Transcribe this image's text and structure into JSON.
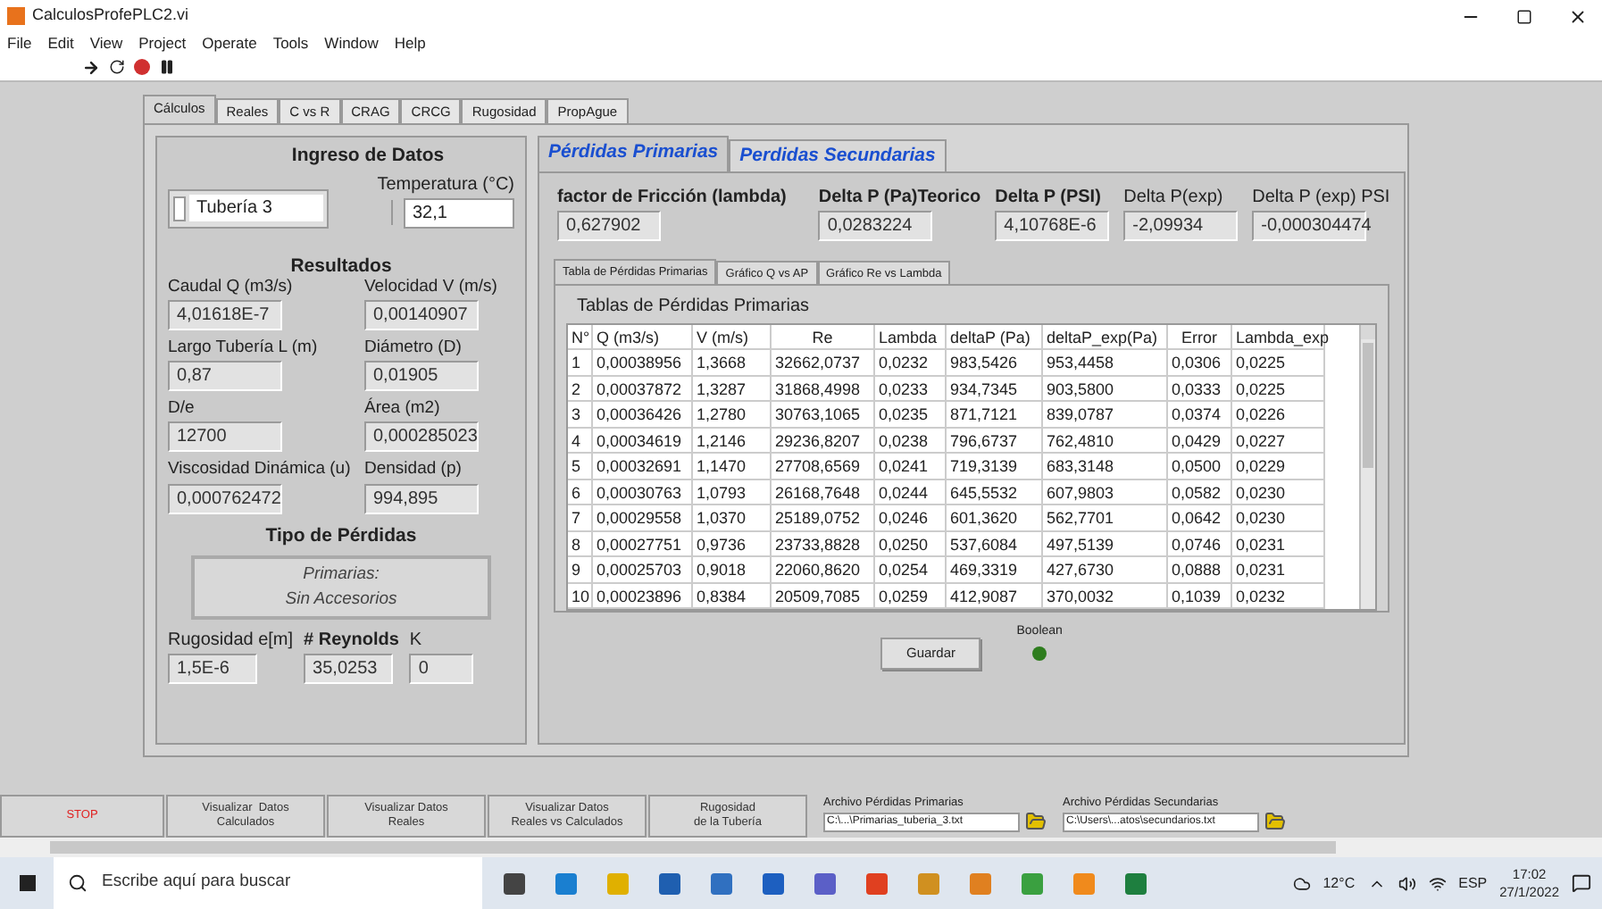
{
  "window": {
    "title": "CalculosProfePLC2.vi"
  },
  "menu": [
    "File",
    "Edit",
    "View",
    "Project",
    "Operate",
    "Tools",
    "Window",
    "Help"
  ],
  "tabs": [
    {
      "label": "Cálculos",
      "selected": true
    },
    {
      "label": "Reales",
      "selected": false
    },
    {
      "label": "C vs R",
      "selected": false
    },
    {
      "label": "CRAG",
      "selected": false
    },
    {
      "label": "CRCG",
      "selected": false
    },
    {
      "label": "Rugosidad",
      "selected": false
    },
    {
      "label": "PropAgue",
      "selected": false
    }
  ],
  "ingreso": {
    "title": "Ingreso de Datos",
    "pipe": "Tubería 3",
    "temp_label": "Temperatura (°C)",
    "temp_value": "32,1"
  },
  "resultados": {
    "title": "Resultados",
    "fields": [
      {
        "label": "Caudal Q (m3/s)",
        "value": "4,01618E-7"
      },
      {
        "label": "Velocidad V (m/s)",
        "value": "0,00140907"
      },
      {
        "label": "Largo Tubería L (m)",
        "value": "0,87"
      },
      {
        "label": "Diámetro (D)",
        "value": "0,01905"
      },
      {
        "label": "D/e",
        "value": "12700"
      },
      {
        "label": "Área (m2)",
        "value": "0,000285023"
      },
      {
        "label": "Viscosidad Dinámica (u)",
        "value": "0,000762472"
      },
      {
        "label": "Densidad (p)",
        "value": "994,895"
      }
    ]
  },
  "tipo": {
    "title": "Tipo de Pérdidas",
    "lines": [
      "Primarias:",
      "Sin Accesorios"
    ]
  },
  "bottom_fields": [
    {
      "label": "Rugosidad e[m]",
      "value": "1,5E-6",
      "bold": false
    },
    {
      "label": "# Reynolds",
      "value": "35,0253",
      "bold": true
    },
    {
      "label": "K",
      "value": "0",
      "bold": false
    }
  ],
  "subtabs": [
    {
      "label": "Pérdidas Primarias",
      "selected": true
    },
    {
      "label": "Perdidas Secundarias",
      "selected": false
    }
  ],
  "summary": [
    {
      "label": "factor de Fricción (lambda)",
      "value": "0,627902",
      "bold": true
    },
    {
      "label": "Delta P (Pa)Teorico",
      "value": "0,0283224",
      "bold": true
    },
    {
      "label": "Delta P (PSI)",
      "value": "4,10768E-6",
      "bold": true
    },
    {
      "label": "Delta P(exp)",
      "value": "-2,09934",
      "bold": false
    },
    {
      "label": "Delta P (exp) PSI",
      "value": "-0,000304474",
      "bold": false
    }
  ],
  "inner_tabs": [
    {
      "label": "Tabla de Pérdidas Primarias",
      "selected": true
    },
    {
      "label": "Gráfico Q vs AP",
      "selected": false
    },
    {
      "label": "Gráfico Re vs Lambda",
      "selected": false
    }
  ],
  "table": {
    "title": "Tablas de Pérdidas Primarias",
    "columns": [
      "N°",
      "Q (m3/s)",
      "V (m/s)",
      "Re",
      "Lambda",
      "deltaP (Pa)",
      "deltaP_exp(Pa)",
      "Error",
      "Lambda_exp"
    ],
    "rows": [
      [
        "1",
        "0,00038956",
        "1,3668",
        "32662,0737",
        "0,0232",
        "983,5426",
        "953,4458",
        "0,0306",
        "0,0225"
      ],
      [
        "2",
        "0,00037872",
        "1,3287",
        "31868,4998",
        "0,0233",
        "934,7345",
        "903,5800",
        "0,0333",
        "0,0225"
      ],
      [
        "3",
        "0,00036426",
        "1,2780",
        "30763,1065",
        "0,0235",
        "871,7121",
        "839,0787",
        "0,0374",
        "0,0226"
      ],
      [
        "4",
        "0,00034619",
        "1,2146",
        "29236,8207",
        "0,0238",
        "796,6737",
        "762,4810",
        "0,0429",
        "0,0227"
      ],
      [
        "5",
        "0,00032691",
        "1,1470",
        "27708,6569",
        "0,0241",
        "719,3139",
        "683,3148",
        "0,0500",
        "0,0229"
      ],
      [
        "6",
        "0,00030763",
        "1,0793",
        "26168,7648",
        "0,0244",
        "645,5532",
        "607,9803",
        "0,0582",
        "0,0230"
      ],
      [
        "7",
        "0,00029558",
        "1,0370",
        "25189,0752",
        "0,0246",
        "601,3620",
        "562,7701",
        "0,0642",
        "0,0230"
      ],
      [
        "8",
        "0,00027751",
        "0,9736",
        "23733,8828",
        "0,0250",
        "537,6084",
        "497,5139",
        "0,0746",
        "0,0231"
      ],
      [
        "9",
        "0,00025703",
        "0,9018",
        "22060,8620",
        "0,0254",
        "469,3319",
        "427,6730",
        "0,0888",
        "0,0231"
      ],
      [
        "10",
        "0,00023896",
        "0,8384",
        "20509,7085",
        "0,0259",
        "412,9087",
        "370,0032",
        "0,1039",
        "0,0232"
      ]
    ]
  },
  "save_button": "Guardar",
  "indicator": {
    "label": "Boolean",
    "on": true
  },
  "buttons": [
    {
      "kind": "stop",
      "lines": [
        "STOP"
      ]
    },
    {
      "kind": "normal",
      "lines": [
        "Visualizar  Datos",
        "Calculados"
      ]
    },
    {
      "kind": "normal",
      "lines": [
        "Visualizar Datos",
        "Reales"
      ]
    },
    {
      "kind": "normal",
      "lines": [
        "Visualizar Datos",
        "Reales vs Calculados"
      ]
    },
    {
      "kind": "normal",
      "lines": [
        "Rugosidad",
        "de la Tubería"
      ]
    }
  ],
  "files": [
    {
      "label": "Archivo Pérdidas Primarias",
      "path": "C:\\...\\Primarias_tuberia_3.txt"
    },
    {
      "label": "Archivo Pérdidas Secundarias",
      "path": "C:\\Users\\...atos\\secundarios.txt"
    }
  ],
  "taskbar": {
    "search_placeholder": "Escribe aquí para buscar",
    "weather": "12°C",
    "language": "ESP",
    "time": "17:02",
    "date": "27/1/2022"
  }
}
